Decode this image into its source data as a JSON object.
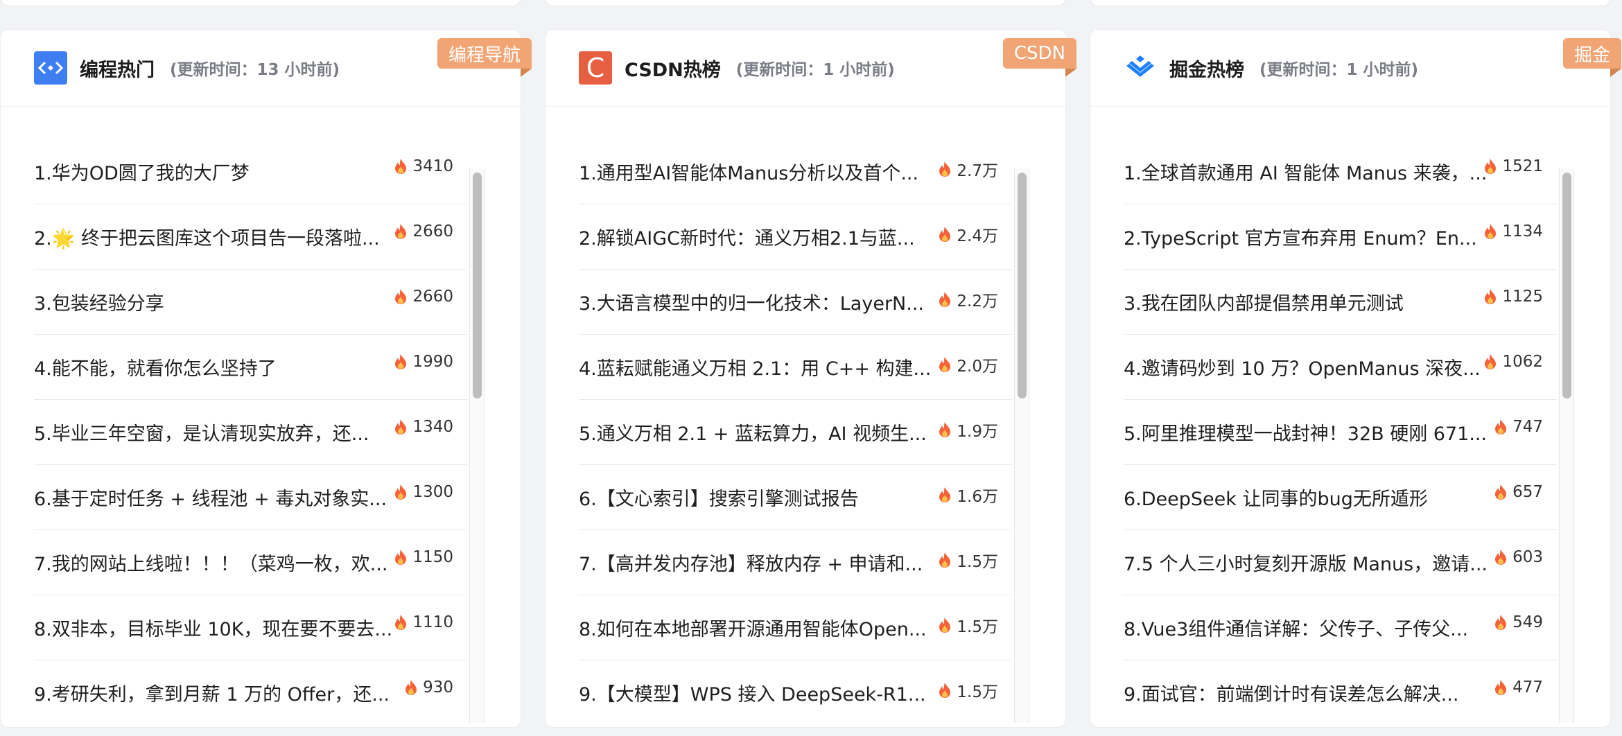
{
  "colors": {
    "ribbon": "#f1a574",
    "csdn": "#e65f40",
    "juejin": "#1e80ff",
    "coding": "#3f7ef0",
    "flame": "#f5623a"
  },
  "cards": [
    {
      "title": "编程热门",
      "update": "(更新时间：13 小时前)",
      "ribbon": "编程导航",
      "logo_icon": "code-brackets-icon",
      "items": [
        {
          "title": "1.华为OD圆了我的大厂梦",
          "heat": "3410"
        },
        {
          "title": "2.🌟 终于把云图库这个项目告一段落啦...",
          "heat": "2660"
        },
        {
          "title": "3.包装经验分享",
          "heat": "2660"
        },
        {
          "title": "4.能不能，就看你怎么坚持了",
          "heat": "1990"
        },
        {
          "title": "5.毕业三年空窗，是认清现实放弃，还...",
          "heat": "1340"
        },
        {
          "title": "6.基于定时任务 + 线程池 + 毒丸对象实...",
          "heat": "1300"
        },
        {
          "title": "7.我的网站上线啦！！！（菜鸡一枚，欢...",
          "heat": "1150"
        },
        {
          "title": "8.双非本，目标毕业 10K，现在要不要去...",
          "heat": "1110"
        },
        {
          "title": "9.考研失利，拿到月薪 1 万的 Offer，还...",
          "heat": "930"
        }
      ]
    },
    {
      "title": "CSDN热榜",
      "update": "(更新时间：1 小时前)",
      "ribbon": "CSDN",
      "logo_icon": "csdn-c-icon",
      "logo_letter": "C",
      "items": [
        {
          "title": "1.通用型AI智能体Manus分析以及首个...",
          "heat": "2.7万"
        },
        {
          "title": "2.解锁AIGC新时代：通义万相2.1与蓝...",
          "heat": "2.4万"
        },
        {
          "title": "3.大语言模型中的归一化技术：LayerN...",
          "heat": "2.2万"
        },
        {
          "title": "4.蓝耘赋能通义万相 2.1：用 C++ 构建...",
          "heat": "2.0万"
        },
        {
          "title": "5.通义万相 2.1 + 蓝耘算力，AI 视频生...",
          "heat": "1.9万"
        },
        {
          "title": "6.【文心索引】搜索引擎测试报告",
          "heat": "1.6万"
        },
        {
          "title": "7.【高并发内存池】释放内存 + 申请和...",
          "heat": "1.5万"
        },
        {
          "title": "8.如何在本地部署开源通用智能体Open...",
          "heat": "1.5万"
        },
        {
          "title": "9.【大模型】WPS 接入 DeepSeek-R1...",
          "heat": "1.5万"
        }
      ]
    },
    {
      "title": "掘金热榜",
      "update": "(更新时间：1 小时前)",
      "ribbon": "掘金",
      "logo_icon": "juejin-logo-icon",
      "items": [
        {
          "title": "1.全球首款通用 AI 智能体 Manus 来袭，...",
          "heat": "1521"
        },
        {
          "title": "2.TypeScript 官方宣布弃用 Enum？En...",
          "heat": "1134"
        },
        {
          "title": "3.我在团队内部提倡禁用单元测试",
          "heat": "1125"
        },
        {
          "title": "4.邀请码炒到 10 万？OpenManus 深夜...",
          "heat": "1062"
        },
        {
          "title": "5.阿里推理模型一战封神！32B 硬刚 671...",
          "heat": "747"
        },
        {
          "title": "6.DeepSeek 让同事的bug无所遁形",
          "heat": "657"
        },
        {
          "title": "7.5 个人三小时复刻开源版 Manus，邀请...",
          "heat": "603"
        },
        {
          "title": "8.Vue3组件通信详解：父传子、子传父...",
          "heat": "549"
        },
        {
          "title": "9.面试官：前端倒计时有误差怎么解决...",
          "heat": "477"
        }
      ]
    }
  ]
}
